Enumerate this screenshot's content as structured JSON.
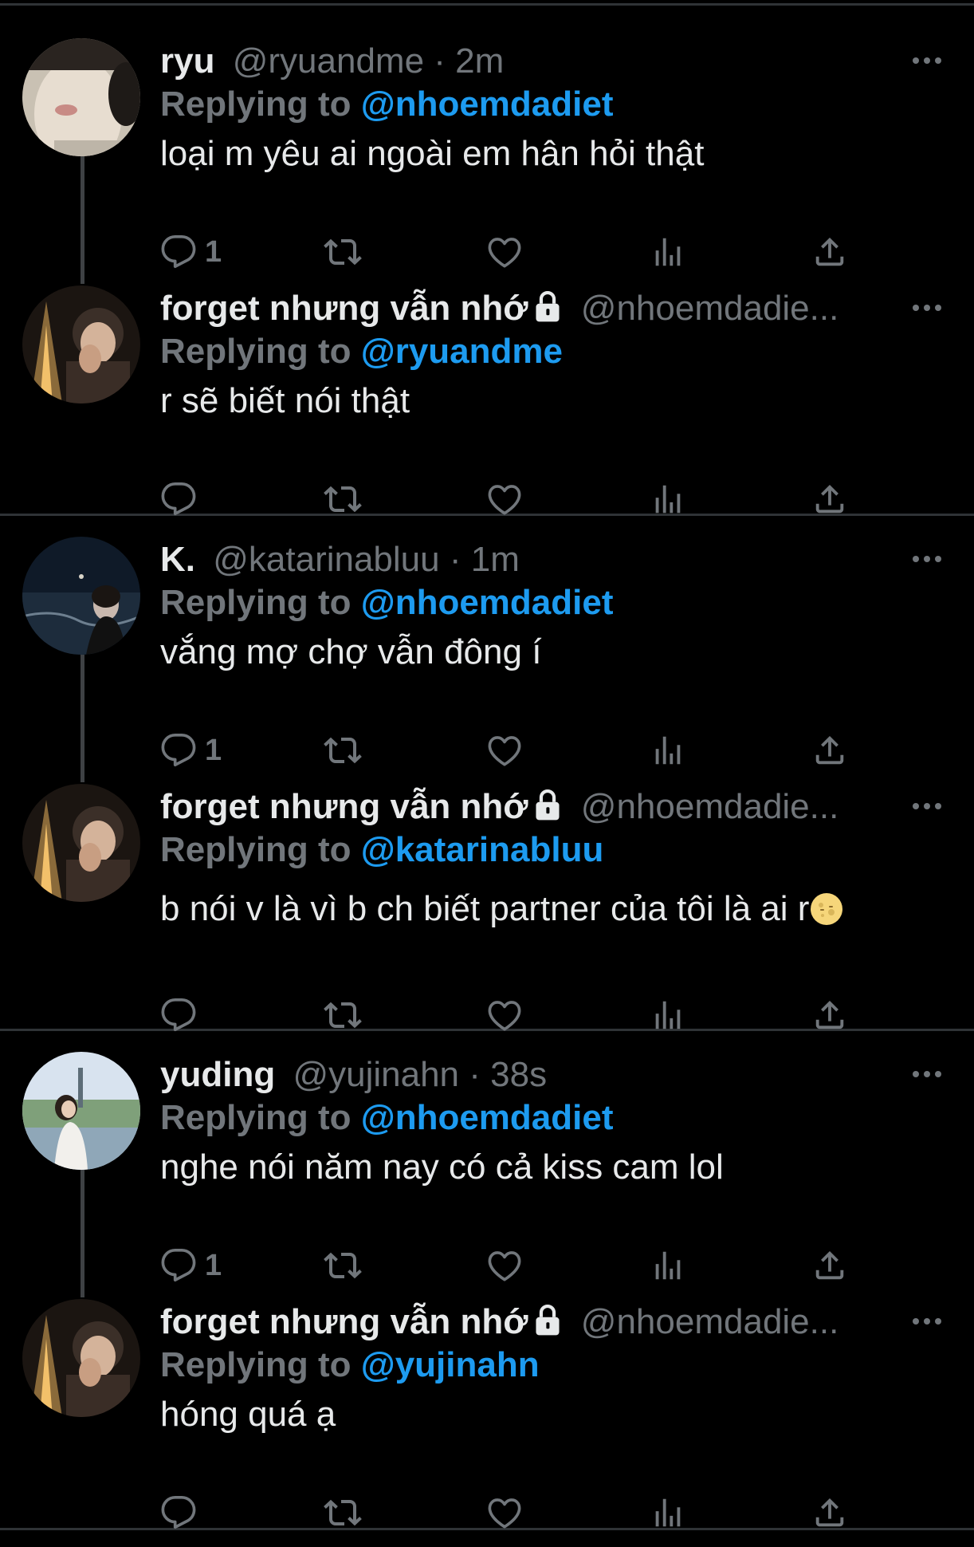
{
  "colors": {
    "background": "#000000",
    "text": "#e7e9ea",
    "muted": "#71767b",
    "link": "#1d9bf0",
    "divider": "#2f3336"
  },
  "icons": {
    "reply": "reply-icon",
    "retweet": "retweet-icon",
    "like": "heart-icon",
    "views": "views-icon",
    "share": "share-icon",
    "more": "more-icon",
    "lock": "lock-icon",
    "emoji": "moon-emoji"
  },
  "tweets": [
    {
      "name": "ryu",
      "handle": "@ryuandme",
      "sep": "·",
      "time": "2m",
      "replying_prefix": "Replying to",
      "replying_to": "@nhoemdadiet",
      "text": "loại m yêu ai ngoài em hân hỏi thật",
      "reply_count": "1"
    },
    {
      "name": "forget nhưng vẫn nhớ",
      "handle": "@nhoemdadie...",
      "replying_prefix": "Replying to",
      "replying_to": "@ryuandme",
      "text": "r sẽ biết nói thật"
    },
    {
      "name": "K.",
      "handle": "@katarinabluu",
      "sep": "·",
      "time": "1m",
      "replying_prefix": "Replying to",
      "replying_to": "@nhoemdadiet",
      "text": "vắng mợ chợ vẫn đông í",
      "reply_count": "1"
    },
    {
      "name": "forget nhưng vẫn nhớ",
      "handle": "@nhoemdadie...",
      "replying_prefix": "Replying to",
      "replying_to": "@katarinabluu",
      "text": "b nói v là vì b ch biết partner của tôi là ai r"
    },
    {
      "name": "yuding",
      "handle": "@yujinahn",
      "sep": "·",
      "time": "38s",
      "replying_prefix": "Replying to",
      "replying_to": "@nhoemdadiet",
      "text": "nghe nói năm nay có cả kiss cam lol",
      "reply_count": "1"
    },
    {
      "name": "forget nhưng vẫn nhớ",
      "handle": "@nhoemdadie...",
      "replying_prefix": "Replying to",
      "replying_to": "@yujinahn",
      "text": "hóng quá ạ"
    }
  ]
}
